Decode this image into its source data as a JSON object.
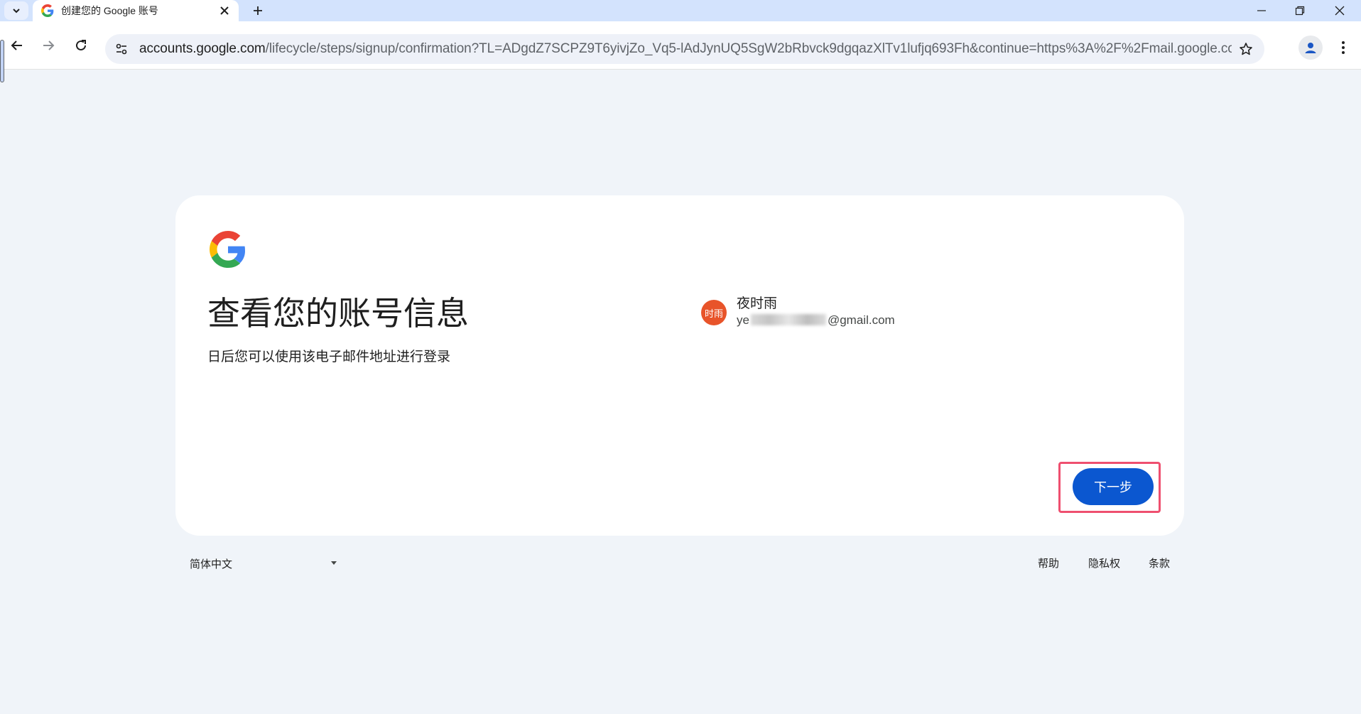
{
  "browser": {
    "tab_title": "创建您的 Google 账号",
    "url_host": "accounts.google.com",
    "url_path": "/lifecycle/steps/signup/confirmation?TL=ADgdZ7SCPZ9T6yivjZo_Vq5-lAdJynUQ5SgW2bRbvck9dgqazXlTv1lufjq693Fh&continue=https%3A%2F%2Fmail.google.co..."
  },
  "card": {
    "headline": "查看您的账号信息",
    "subtext": "日后您可以使用该电子邮件地址进行登录",
    "account": {
      "avatar_text": "时雨",
      "name": "夜时雨",
      "email_prefix": "ye",
      "email_domain": "@gmail.com"
    },
    "next_label": "下一步"
  },
  "footer": {
    "language": "简体中文",
    "help": "帮助",
    "privacy": "隐私权",
    "terms": "条款"
  },
  "colors": {
    "primary": "#0b57d0",
    "highlight": "#ef4f6f",
    "avatar": "#e8542a",
    "page_bg": "#f0f4f9"
  }
}
